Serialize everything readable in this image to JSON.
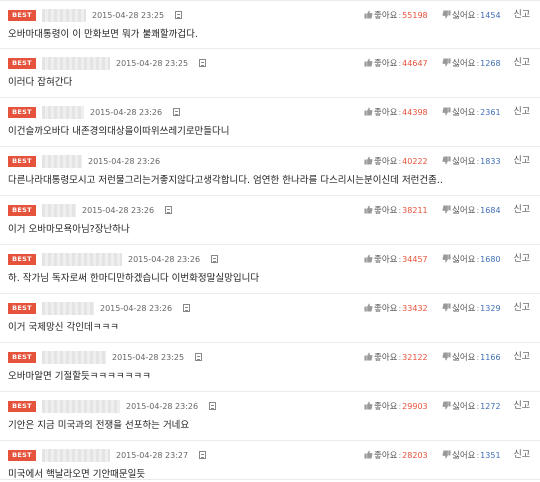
{
  "ui": {
    "best_label": "BEST",
    "like_label": "좋아요",
    "dislike_label": "싫어요",
    "separator": ":",
    "report_label": "신고",
    "colors": {
      "best_badge": "#e5533c",
      "like_count": "#e5533c",
      "dislike_count": "#3f6fb5"
    }
  },
  "comments": [
    {
      "date": "2015-04-28 23:25",
      "text": "오바마대통령이 이 만화보면 뭐가 불쾌할까겁다.",
      "likes": "55198",
      "dislikes": "1454"
    },
    {
      "date": "2015-04-28 23:25",
      "text": "이러다 잡혀간다",
      "likes": "44647",
      "dislikes": "1268"
    },
    {
      "date": "2015-04-28 23:26",
      "text": "이건슬까오바다 내존경의대상을이따위쓰레기로만들다니",
      "likes": "44398",
      "dislikes": "2361"
    },
    {
      "date": "2015-04-28 23:26",
      "text": "다른나라대통령모시고 저런물그리는거좋지않다고생각합니다. 엄연한 한나라를 다스리시는분이신데 저런건좀..",
      "likes": "40222",
      "dislikes": "1833"
    },
    {
      "date": "2015-04-28 23:26",
      "text": "이거 오바마모욕아님?장난하나",
      "likes": "38211",
      "dislikes": "1684"
    },
    {
      "date": "2015-04-28 23:26",
      "text": "하. 작가님 독자로써 한마디만하겠습니다 이번화정말실망입니다",
      "likes": "34457",
      "dislikes": "1680"
    },
    {
      "date": "2015-04-28 23:26",
      "text": "이거 국제망신 각인데ㅋㅋㅋ",
      "likes": "33432",
      "dislikes": "1329"
    },
    {
      "date": "2015-04-28 23:25",
      "text": "오바마알면 기절할듯ㅋㅋㅋㅋㅋㅋㅋ",
      "likes": "32122",
      "dislikes": "1166"
    },
    {
      "date": "2015-04-28 23:26",
      "text": "기안은 지금 미국과의 전쟁을 선포하는 거네요",
      "likes": "29903",
      "dislikes": "1272"
    },
    {
      "date": "2015-04-28 23:27",
      "text": "미국에서 핵날라오면 기안때문일듯",
      "likes": "28203",
      "dislikes": "1351"
    }
  ]
}
